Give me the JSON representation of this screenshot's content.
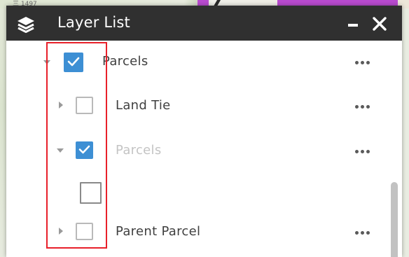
{
  "header": {
    "title": "Layer List",
    "icon": "layers-icon"
  },
  "map": {
    "corner_text": "三 1497"
  },
  "layers": [
    {
      "label": "Parcels",
      "checked": true,
      "expanded": true,
      "dimmed": false
    },
    {
      "label": "Land Tie",
      "checked": false,
      "expanded": false,
      "dimmed": false
    },
    {
      "label": "Parcels",
      "checked": true,
      "expanded": true,
      "dimmed": true
    },
    {
      "label": "",
      "checked": false,
      "expanded": false,
      "dimmed": false
    },
    {
      "label": "Parent Parcel",
      "checked": false,
      "expanded": false,
      "dimmed": false
    }
  ],
  "colors": {
    "header_bg": "#303030",
    "checkbox_checked": "#3d8fd4",
    "highlight": "#e8202a"
  }
}
